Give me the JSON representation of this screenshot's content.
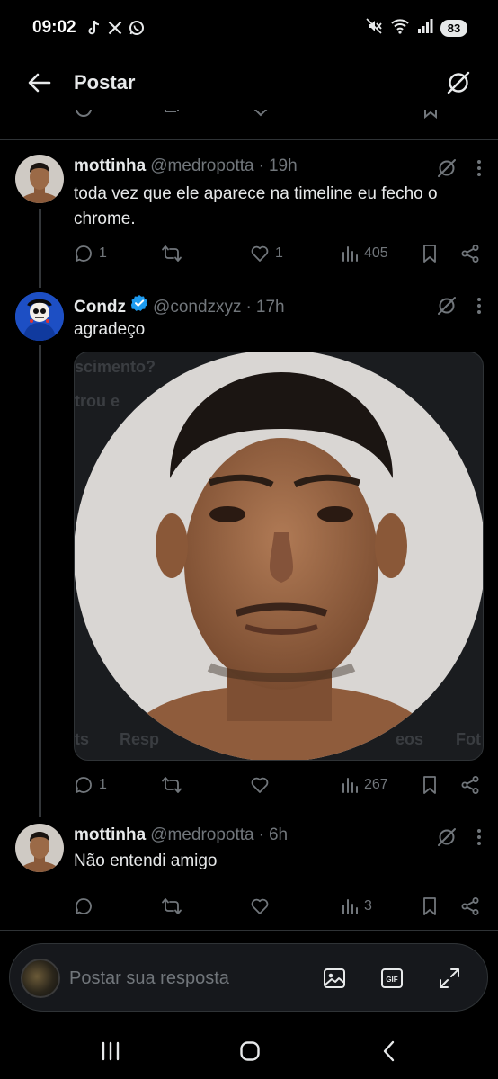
{
  "status_bar": {
    "time": "09:02",
    "apps": [
      "tiktok-icon",
      "x-icon",
      "whatsapp-icon"
    ],
    "system_icons": [
      "mute-icon",
      "wifi-icon",
      "signal-icon"
    ],
    "battery": "83"
  },
  "topbar": {
    "title": "Postar"
  },
  "tweets": [
    {
      "name": "mottinha",
      "handle": "@medropotta",
      "separator": "·",
      "time": "19h",
      "text": "toda vez que ele aparece na timeline eu fecho o chrome.",
      "replies": "1",
      "reposts": "",
      "likes": "1",
      "views": "405"
    },
    {
      "name": "Condz",
      "verified": true,
      "handle": "@condzxyz",
      "separator": "·",
      "time": "17h",
      "text": "agradeço",
      "replies": "1",
      "reposts": "",
      "likes": "",
      "views": "267",
      "media_ghost_text": [
        "scimento?",
        "trou e",
        "ts",
        "Resp",
        "eos",
        "Fot"
      ]
    },
    {
      "name": "mottinha",
      "handle": "@medropotta",
      "separator": "·",
      "time": "6h",
      "text": "Não entendi amigo",
      "replies": "",
      "reposts": "",
      "likes": "",
      "views": "3"
    }
  ],
  "reply_bar": {
    "placeholder": "Postar sua resposta"
  },
  "colors": {
    "background": "#000000",
    "text": "#e7e9ea",
    "muted": "#71767b",
    "divider": "#2f3336",
    "verified": "#1d9bf0"
  }
}
